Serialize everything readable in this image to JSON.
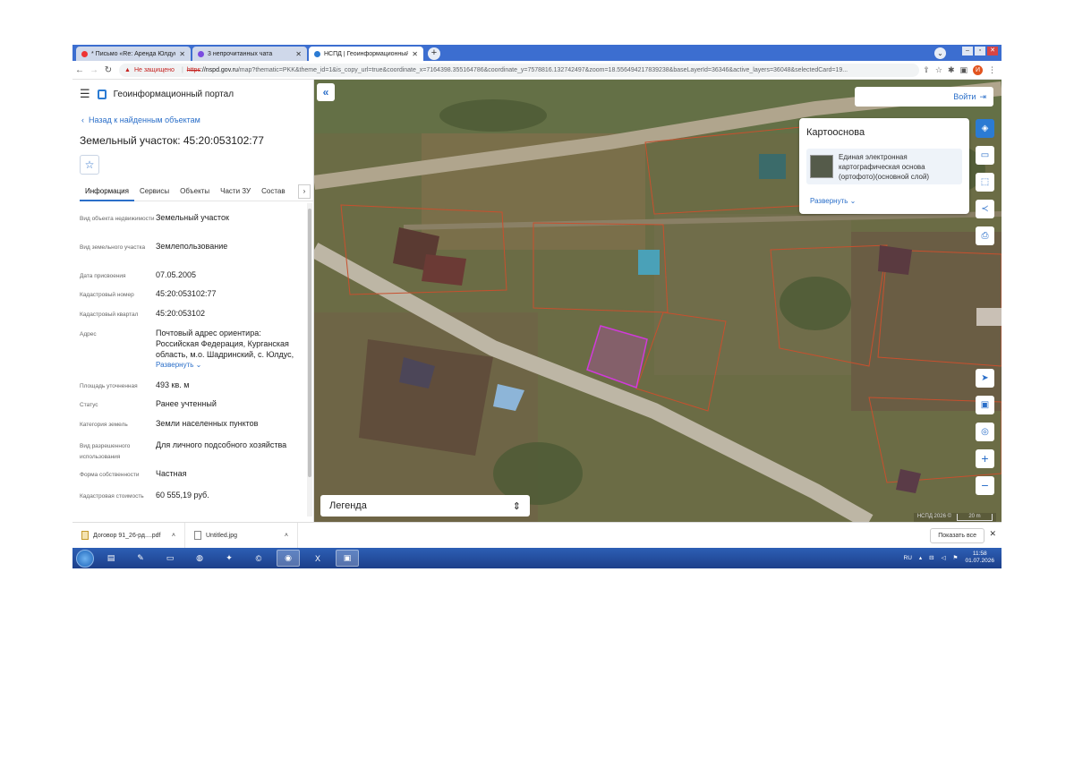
{
  "browser": {
    "tabs": [
      {
        "label": "* Письмо «Re: Аренда Юлдус»",
        "active": false
      },
      {
        "label": "3 непрочитанных чата",
        "active": false
      },
      {
        "label": "НСПД | Геоинформационный п",
        "active": true
      }
    ],
    "close_glyph": "✕",
    "new_tab_glyph": "+",
    "security_warning": "Не защищено",
    "url_https": "https",
    "url_host": "://nspd.gov.ru",
    "url_rest": "/map?thematic=PKK&theme_id=1&is_copy_url=true&coordinate_x=7164398.355164786&coordinate_y=7578816.132742497&zoom=18.556494217839238&baseLayerId=36346&active_layers=36048&selectedCard=19...",
    "profile_initial": "И"
  },
  "panel": {
    "app_title": "Геоинформационный портал",
    "back_link": "Назад к найденным объектам",
    "object_title": "Земельный участок: 45:20:053102:77",
    "tabs": [
      "Информация",
      "Сервисы",
      "Объекты",
      "Части ЗУ",
      "Состав"
    ],
    "rows": [
      {
        "label": "Вид объекта недвижимости",
        "value": "Земельный участок"
      },
      {
        "label": "Вид земельного участка",
        "value": "Землепользование"
      },
      {
        "label": "Дата присвоения",
        "value": "07.05.2005"
      },
      {
        "label": "Кадастровый номер",
        "value": "45:20:053102:77"
      },
      {
        "label": "Кадастровый квартал",
        "value": "45:20:053102"
      },
      {
        "label": "Адрес",
        "value": "Почтовый адрес ориентира: Российская Федерация, Курганская область, м.о. Шадринский, с. Юлдус,"
      },
      {
        "label": "Площадь уточненная",
        "value": "493 кв. м"
      },
      {
        "label": "Статус",
        "value": "Ранее учтенный"
      },
      {
        "label": "Категория земель",
        "value": "Земли населенных пунктов"
      },
      {
        "label": "Вид разрешенного использования",
        "value": "Для личного подсобного хозяйства"
      },
      {
        "label": "Форма собственности",
        "value": "Частная"
      },
      {
        "label": "Кадастровая стоимость",
        "value": "60 555,19 руб."
      }
    ],
    "expand_label": "Развернуть"
  },
  "map": {
    "login_label": "Войти",
    "basemap_title": "Картооснова",
    "basemap_item": "Единая электронная картографическая основа (ортофото)(основной слой)",
    "basemap_more": "Развернуть",
    "legend_label": "Легенда",
    "attribution": "НСПД 2026 ©",
    "scale_label": "20 m",
    "parcel_highlight_color": "#d13adb",
    "parcel_border_color": "#c8502e"
  },
  "downloads": {
    "items": [
      "Договор 91_26-рд....pdf",
      "Untitled.jpg"
    ],
    "show_all": "Показать все"
  },
  "taskbar": {
    "lang": "RU",
    "time": "11:58",
    "date": "01.07.2026"
  }
}
